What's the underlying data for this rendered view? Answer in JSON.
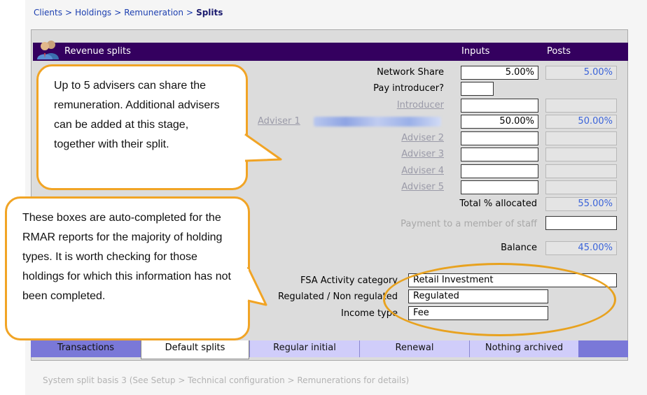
{
  "breadcrumb": {
    "items": [
      "Clients",
      "Holdings",
      "Remuneration"
    ],
    "current": "Splits",
    "sep": ">"
  },
  "header": {
    "title": "Revenue splits",
    "col_inputs": "Inputs",
    "col_posts": "Posts"
  },
  "rows": {
    "network_share": {
      "label": "Network Share",
      "input": "5.00%",
      "post": "5.00%"
    },
    "pay_introducer": {
      "label": "Pay introducer?"
    },
    "introducer": {
      "label": "Introducer"
    },
    "adviser1": {
      "label": "Adviser 1",
      "input": "50.00%",
      "post": "50.00%"
    },
    "adviser2": {
      "label": "Adviser 2"
    },
    "adviser3": {
      "label": "Adviser 3"
    },
    "adviser4": {
      "label": "Adviser 4"
    },
    "adviser5": {
      "label": "Adviser 5"
    },
    "total": {
      "label": "Total % allocated",
      "post": "55.00%"
    },
    "staff": {
      "label": "Payment to a member of staff"
    },
    "balance": {
      "label": "Balance",
      "post": "45.00%"
    }
  },
  "classification": {
    "fsa": {
      "label": "FSA Activity category",
      "value": "Retail Investment"
    },
    "regulated": {
      "label": "Regulated / Non regulated",
      "value": "Regulated"
    },
    "income": {
      "label": "Income type",
      "value": "Fee"
    }
  },
  "callouts": {
    "advisers": "Up to 5 advisers can share the remuneration. Additional advisers can be added at this stage, together with their split.",
    "rmar": "These boxes are auto-completed for the RMAR reports for the majority of holding types.  It is worth checking for those holdings for which this information has not been completed."
  },
  "tabs": [
    "Transactions",
    "Default splits",
    "Regular initial",
    "Renewal",
    "Nothing archived"
  ],
  "footer_note": "System split basis 3 (See Setup > Technical configuration > Remunerations for details)",
  "colors": {
    "header_bg": "#34005f",
    "callout_border": "#f1a425",
    "tab_bar": "#7a78d8",
    "post_text": "#3a63d9"
  }
}
